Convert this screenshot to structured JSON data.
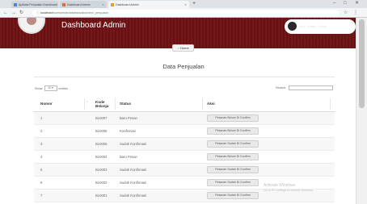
{
  "browser": {
    "tabs": [
      {
        "label": "Aplikasi Penjualan Dashboard",
        "active": false,
        "color": "#4a86c8"
      },
      {
        "label": "Dashboard Admin",
        "active": false,
        "color": "#e06c2b"
      },
      {
        "label": "Dashboard Admin",
        "active": true,
        "color": "#e0a020"
      }
    ],
    "new_tab": "+",
    "url_host": "localhost",
    "url_path": "/bumisehat/datatransaksi/view_penjualan",
    "window_controls": [
      "–",
      "□",
      "✕"
    ]
  },
  "header": {
    "title": "Dashboard Admin",
    "user_name": "Login Sebagai Administrator",
    "user_sub": "Akun Setting • Keluar",
    "brand_color": "#6d1114"
  },
  "nav": {
    "home_label": "Home"
  },
  "page": {
    "title": "Data Penjualan"
  },
  "controls": {
    "show_label": "Show",
    "entries_value": "10",
    "entries_label": "entries",
    "search_label": "Search:"
  },
  "table": {
    "columns": [
      "Nomor",
      "Kode Belanja",
      "Status",
      "Aksi"
    ],
    "rows": [
      {
        "nomor": "1",
        "kode": "BL0007",
        "status": "Baru Pesan",
        "aksi": "Pesanan Belum Di Confirm"
      },
      {
        "nomor": "2",
        "kode": "BL0006",
        "status": "Konfirmasi",
        "aksi": "Pesanan Belum Di Confirm"
      },
      {
        "nomor": "3",
        "kode": "BL0005",
        "status": "Sudah Konfirmasi",
        "aksi": "Pesanan Sudah Di Confirm"
      },
      {
        "nomor": "4",
        "kode": "BL0004",
        "status": "Baru Pesan",
        "aksi": "Pesanan Belum Di Confirm"
      },
      {
        "nomor": "5",
        "kode": "BL0003",
        "status": "Sudah Konfirmasi",
        "aksi": "Pesanan Sudah Di Confirm"
      },
      {
        "nomor": "6",
        "kode": "BL0002",
        "status": "Sudah Konfirmasi",
        "aksi": "Pesanan Sudah Di Confirm"
      },
      {
        "nomor": "7",
        "kode": "BL0001",
        "status": "Sudah Konfirmasi",
        "aksi": "Pesanan Sudah Di Confirm"
      }
    ]
  },
  "watermark": {
    "title": "Activate Windows",
    "sub": "Go to PC settings to activate Windows."
  }
}
